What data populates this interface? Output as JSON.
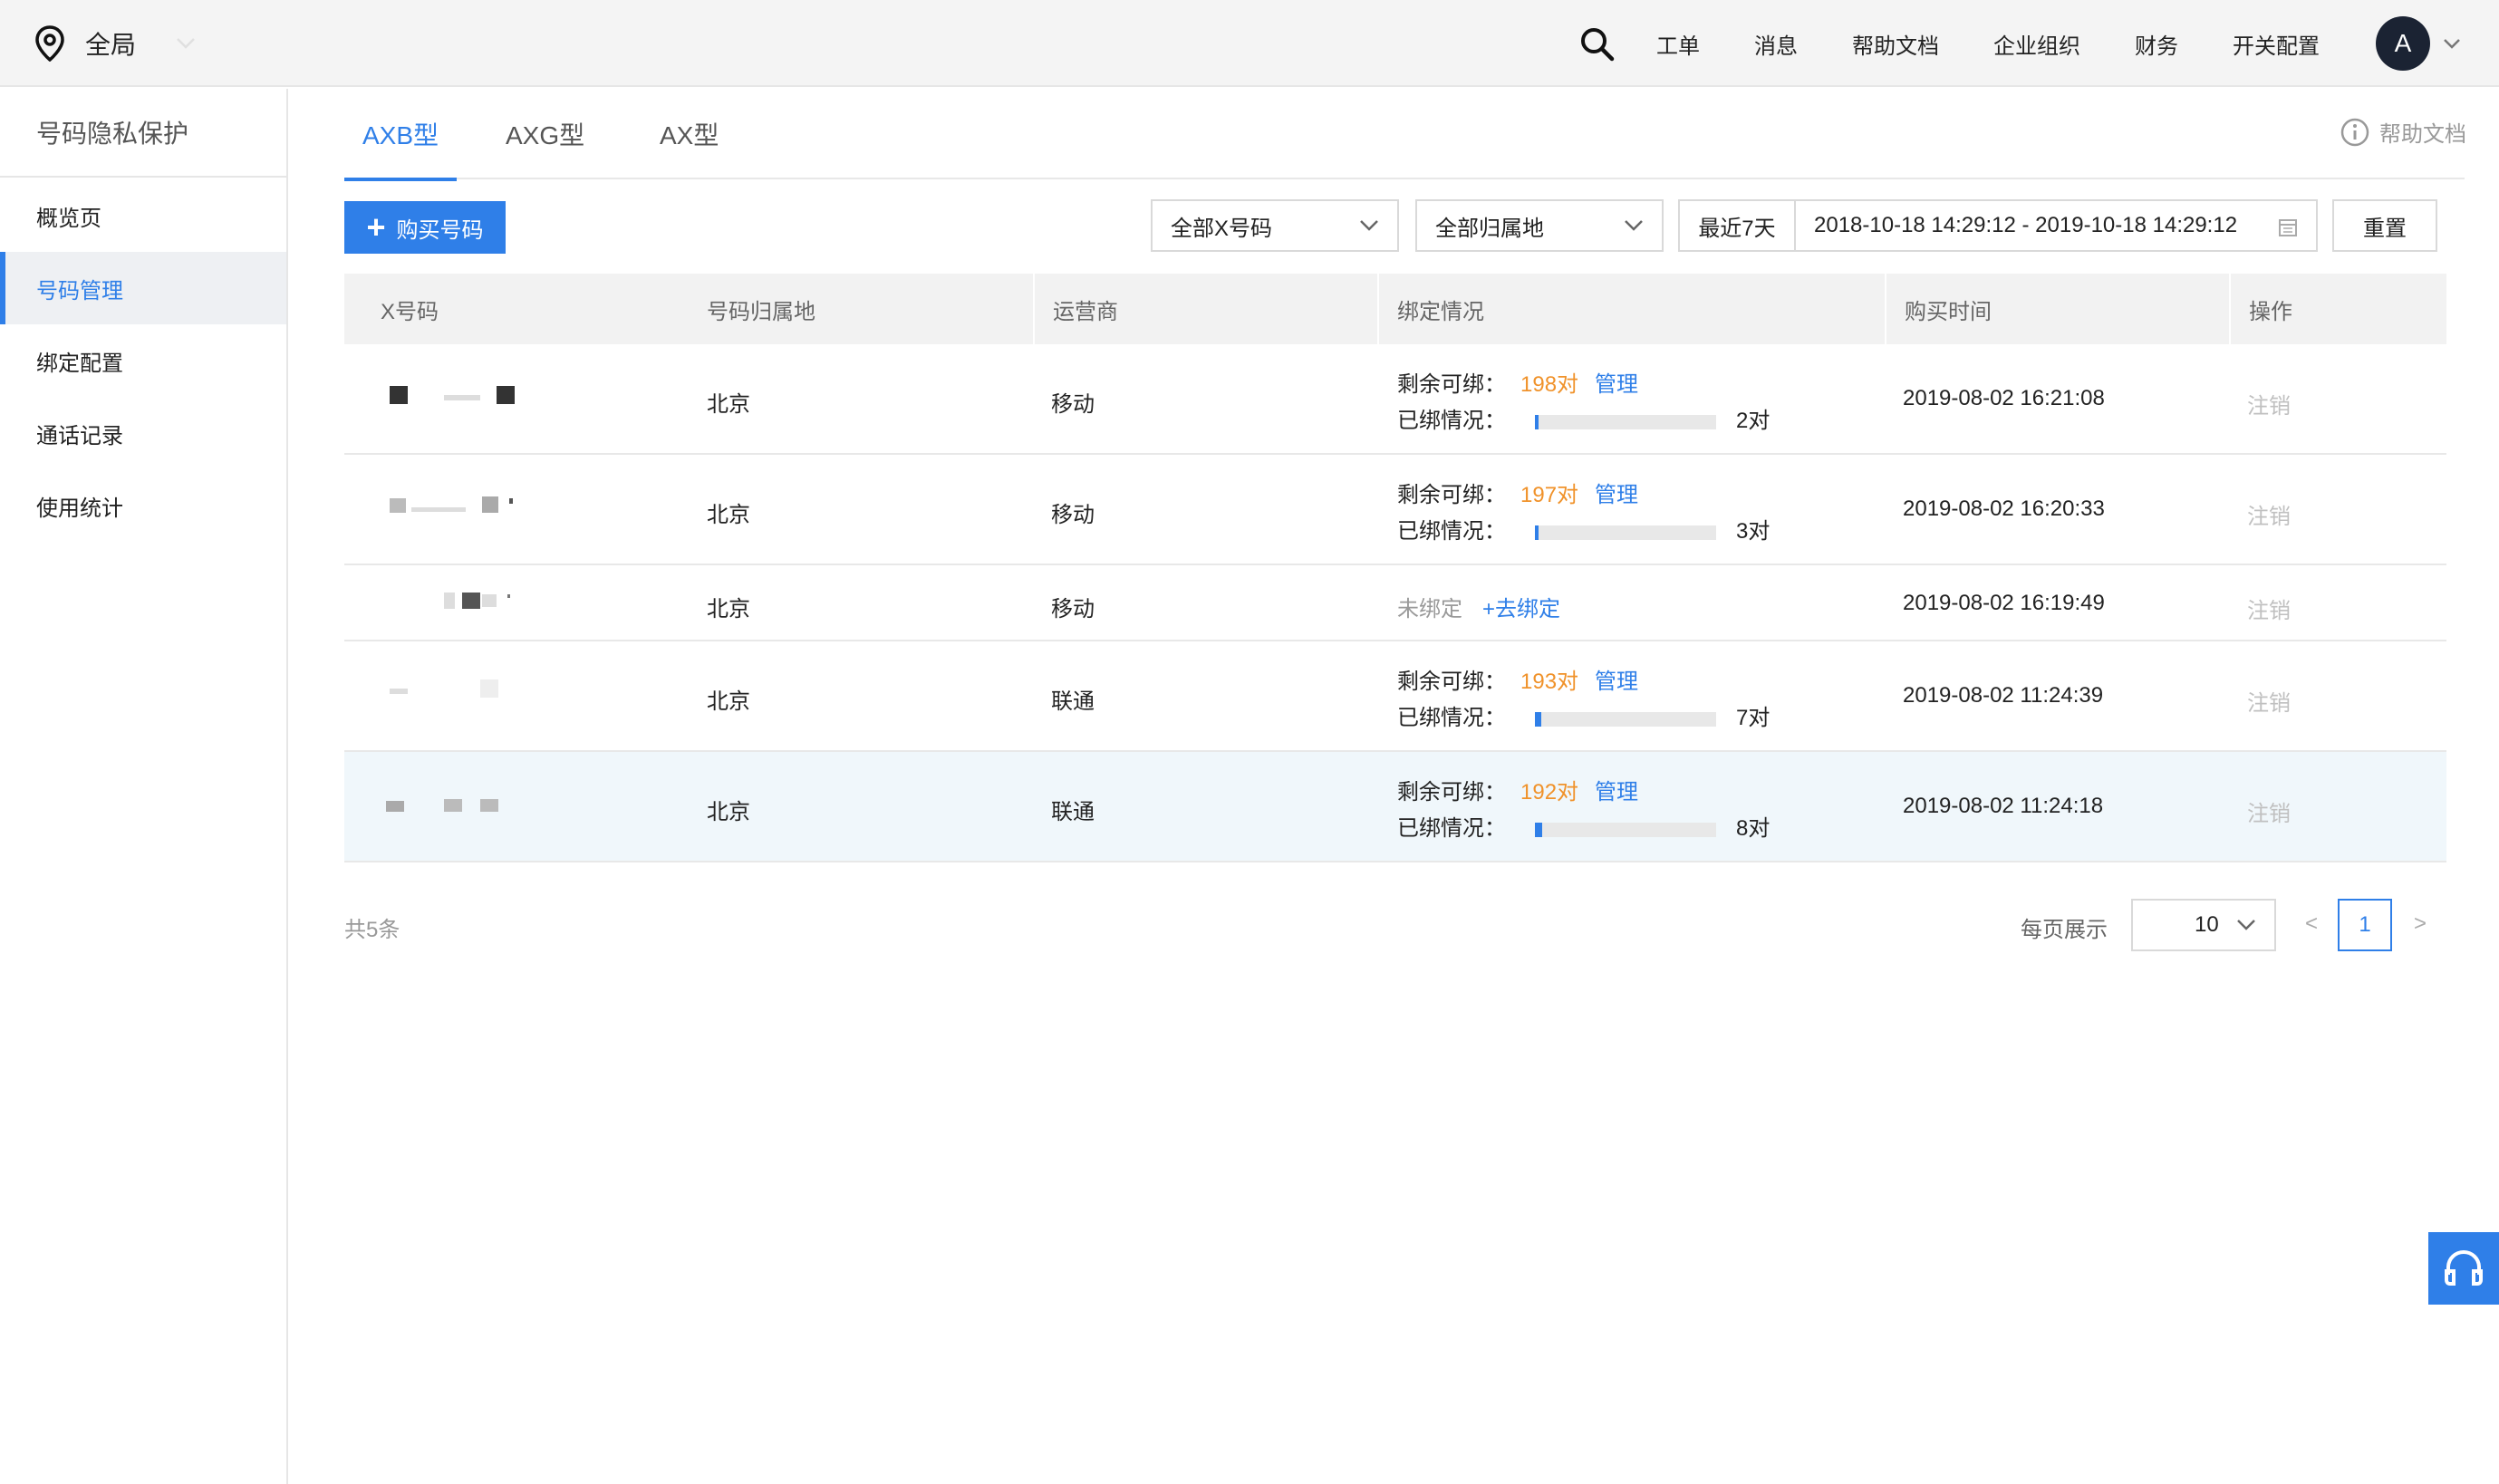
{
  "topbar": {
    "region_label": "全局",
    "nav": [
      "工单",
      "消息",
      "帮助文档",
      "企业组织",
      "财务",
      "开关配置"
    ],
    "avatar_letter": "A"
  },
  "sidebar": {
    "product_title": "号码隐私保护",
    "items": [
      "概览页",
      "号码管理",
      "绑定配置",
      "通话记录",
      "使用统计"
    ],
    "active_index": 1
  },
  "tabs": [
    "AXB型",
    "AXG型",
    "AX型"
  ],
  "help_link": "帮助文档",
  "toolbar": {
    "buy_label": "购买号码",
    "x_filter": "全部X号码",
    "location_filter": "全部归属地",
    "date_preset": "最近7天",
    "date_range": "2018-10-18 14:29:12 - 2019-10-18 14:29:12",
    "reset_label": "重置"
  },
  "table": {
    "headers": [
      "X号码",
      "号码归属地",
      "运营商",
      "绑定情况",
      "购买时间",
      "操作"
    ],
    "labels": {
      "remaining": "剩余可绑：",
      "bound": "已绑情况：",
      "manage": "管理",
      "unbound": "未绑定",
      "go_bind": "+去绑定",
      "cancel": "注销"
    },
    "rows": [
      {
        "location": "北京",
        "carrier": "移动",
        "remaining": "198对",
        "bound_count": "2对",
        "bound_fraction": 0.01,
        "purchase_time": "2019-08-02 16:21:08"
      },
      {
        "location": "北京",
        "carrier": "移动",
        "remaining": "197对",
        "bound_count": "3对",
        "bound_fraction": 0.015,
        "purchase_time": "2019-08-02 16:20:33"
      },
      {
        "location": "北京",
        "carrier": "移动",
        "purchase_time": "2019-08-02 16:19:49"
      },
      {
        "location": "北京",
        "carrier": "联通",
        "remaining": "193对",
        "bound_count": "7对",
        "bound_fraction": 0.035,
        "purchase_time": "2019-08-02 11:24:39"
      },
      {
        "location": "北京",
        "carrier": "联通",
        "remaining": "192对",
        "bound_count": "8对",
        "bound_fraction": 0.04,
        "purchase_time": "2019-08-02 11:24:18"
      }
    ]
  },
  "pagination": {
    "total": "共5条",
    "per_page_label": "每页展示",
    "page_size": "10",
    "prev": "<",
    "current_page": "1",
    "next": ">"
  },
  "colors": {
    "accent": "#2f7fe8",
    "remaining": "#f0922a",
    "muted": "#c0c0c0"
  }
}
